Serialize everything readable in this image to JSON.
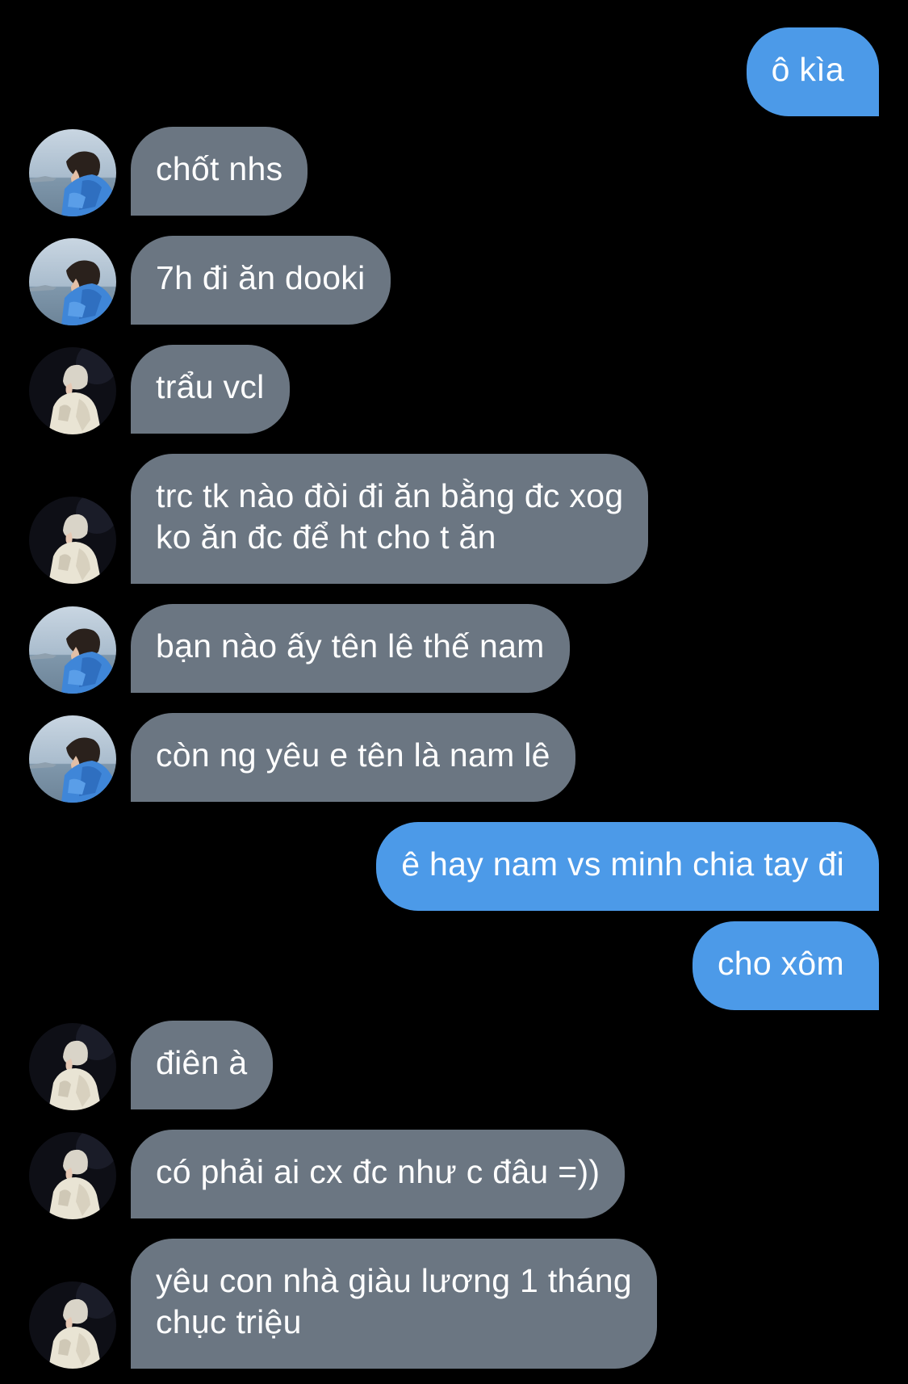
{
  "colors": {
    "background": "#000000",
    "incoming_bubble": "#6b7682",
    "outgoing_bubble": "#4c9ae8",
    "text": "#ffffff"
  },
  "messages": [
    {
      "direction": "out",
      "text": "ô kìa"
    },
    {
      "direction": "in",
      "avatar": "avatar-boy-blue-jacket-icon",
      "text": "chốt nhs"
    },
    {
      "direction": "in",
      "avatar": "avatar-boy-blue-jacket-icon",
      "text": "7h đi ăn dooki"
    },
    {
      "direction": "in",
      "avatar": "avatar-white-hair-cloak-icon",
      "text": "trẩu vcl"
    },
    {
      "direction": "in",
      "avatar": "avatar-white-hair-cloak-icon",
      "text": "trc tk nào đòi đi ăn bằng đc xog\nko ăn đc để ht cho t ăn"
    },
    {
      "direction": "in",
      "avatar": "avatar-boy-blue-jacket-icon",
      "text": "bạn nào ấy tên lê thế nam"
    },
    {
      "direction": "in",
      "avatar": "avatar-boy-blue-jacket-icon",
      "text": "còn ng yêu e tên là nam lê"
    },
    {
      "direction": "out",
      "text": "ê hay nam vs minh chia tay đi"
    },
    {
      "direction": "out",
      "text": "cho xôm"
    },
    {
      "direction": "in",
      "avatar": "avatar-white-hair-cloak-icon",
      "text": "điên à"
    },
    {
      "direction": "in",
      "avatar": "avatar-white-hair-cloak-icon",
      "text": "có phải ai cx đc như c đâu =))"
    },
    {
      "direction": "in",
      "avatar": "avatar-white-hair-cloak-icon",
      "text": "yêu con nhà giàu lương 1 tháng\nchục triệu"
    }
  ]
}
